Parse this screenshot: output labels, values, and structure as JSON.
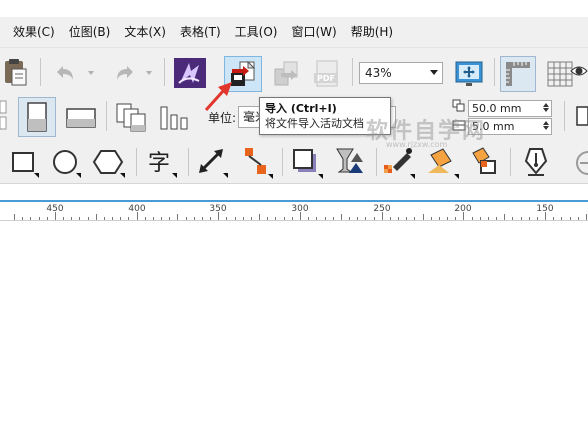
{
  "menubar": {
    "items": [
      {
        "label": "效果(C)"
      },
      {
        "label": "位图(B)"
      },
      {
        "label": "文本(X)"
      },
      {
        "label": "表格(T)"
      },
      {
        "label": "工具(O)"
      },
      {
        "label": "窗口(W)"
      },
      {
        "label": "帮助(H)"
      }
    ]
  },
  "toolbar": {
    "zoom_value": "43%",
    "units_label": "单位:",
    "units_value": "毫米",
    "nudge_value": "50.0 mm",
    "nudge_value2": "5.0 mm",
    "pdf_label": "PDF"
  },
  "tooltip": {
    "title": "导入 (Ctrl+I)",
    "description": "将文件导入活动文档"
  },
  "watermark": {
    "text": "软件自学网",
    "sub": "www.rjzxw.com"
  },
  "ruler": {
    "labels": [
      "450",
      "400",
      "350",
      "300",
      "250",
      "200",
      "150"
    ]
  },
  "colors": {
    "accent": "#4a9bd5",
    "import_hover_bg": "#cde6f7",
    "pointer_red": "#e2352b"
  }
}
